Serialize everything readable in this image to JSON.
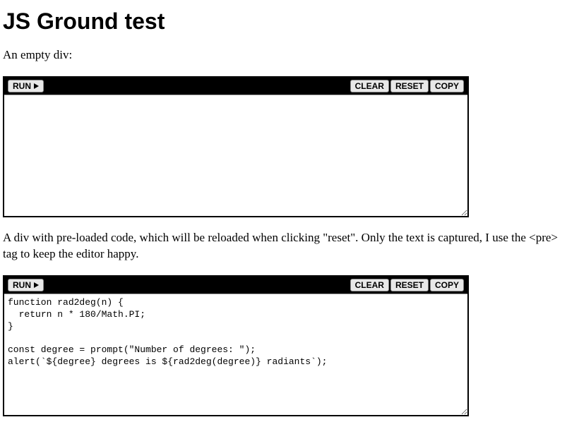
{
  "page": {
    "title": "JS Ground test",
    "para1": "An empty div:",
    "para2": "A div with pre-loaded code, which will be reloaded when clicking \"reset\". Only the text is captured, I use the <pre> tag to keep the editor happy."
  },
  "buttons": {
    "run": "RUN",
    "clear": "CLEAR",
    "reset": "RESET",
    "copy": "COPY"
  },
  "editors": {
    "empty": "",
    "sample": "function rad2deg(n) {\n  return n * 180/Math.PI;\n}\n\nconst degree = prompt(\"Number of degrees: \");\nalert(`${degree} degrees is ${rad2deg(degree)} radiants`);"
  }
}
